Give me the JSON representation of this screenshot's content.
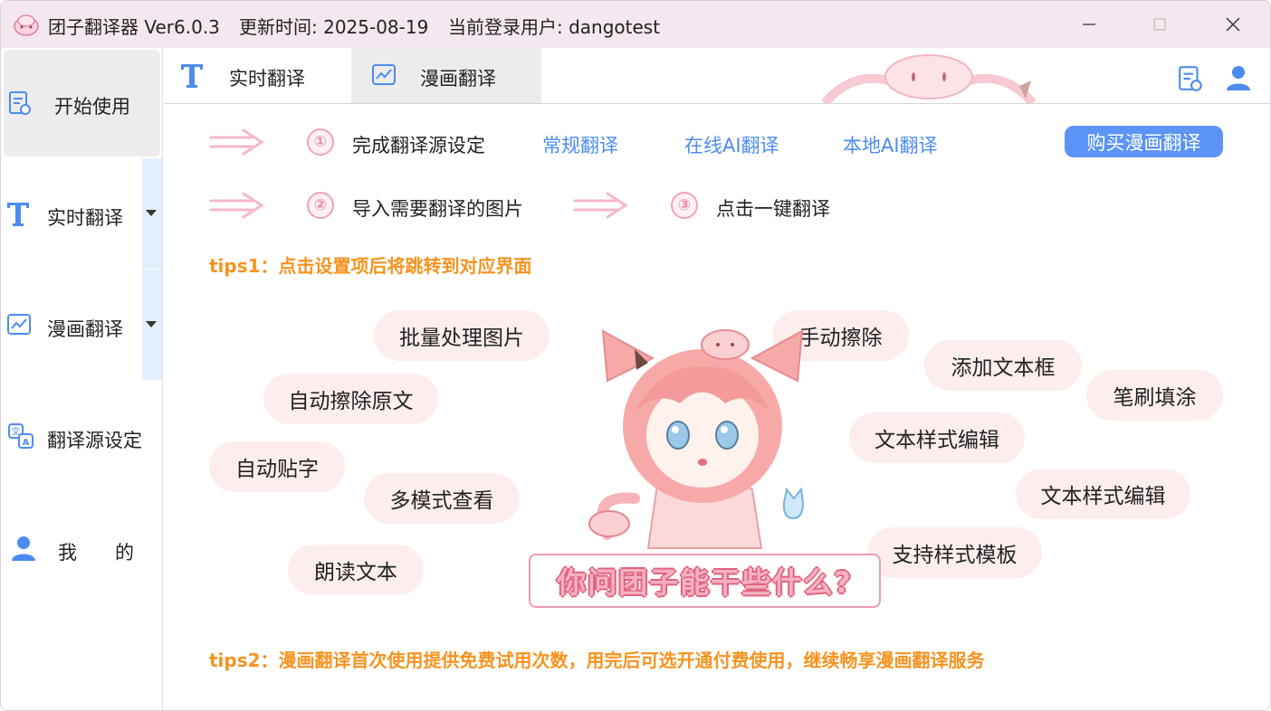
{
  "titlebar": {
    "app_name": "团子翻译器 Ver6.0.3",
    "update_time": "更新时间: 2025-08-19",
    "current_user": "当前登录用户: dangotest"
  },
  "sidebar": {
    "items": [
      {
        "label": "开始使用",
        "icon": "document-icon"
      },
      {
        "label": "实时翻译",
        "icon": "text-T-icon"
      },
      {
        "label": "漫画翻译",
        "icon": "chart-icon"
      },
      {
        "label": "翻译源设定",
        "icon": "translate-icon"
      },
      {
        "label": "我　　的",
        "icon": "user-icon"
      }
    ]
  },
  "tabs": [
    {
      "label": "实时翻译",
      "icon": "text-T-icon"
    },
    {
      "label": "漫画翻译",
      "icon": "chart-icon"
    }
  ],
  "steps": {
    "step1_num": "①",
    "step1": "完成翻译源设定",
    "links": [
      "常规翻译",
      "在线AI翻译",
      "本地AI翻译"
    ],
    "buy_button": "购买漫画翻译",
    "step2_num": "②",
    "step2": "导入需要翻译的图片",
    "step3_num": "③",
    "step3": "点击一键翻译"
  },
  "tips1": "tips1：点击设置项后将跳转到对应界面",
  "tips2": "tips2：漫画翻译首次使用提供免费试用次数，用完后可选开通付费使用，继续畅享漫画翻译服务",
  "features": [
    "批量处理图片",
    "自动擦除原文",
    "自动贴字",
    "多模式查看",
    "朗读文本",
    "手动擦除",
    "添加文本框",
    "笔刷填涂",
    "文本样式编辑",
    "文本样式编辑",
    "支持样式模板"
  ],
  "banner": "你问团子能干些什么?",
  "colors": {
    "accent": "#5b94f5",
    "tips": "#f7931e",
    "bubble": "#fdeeed",
    "titlebar": "#f5e7f0"
  }
}
